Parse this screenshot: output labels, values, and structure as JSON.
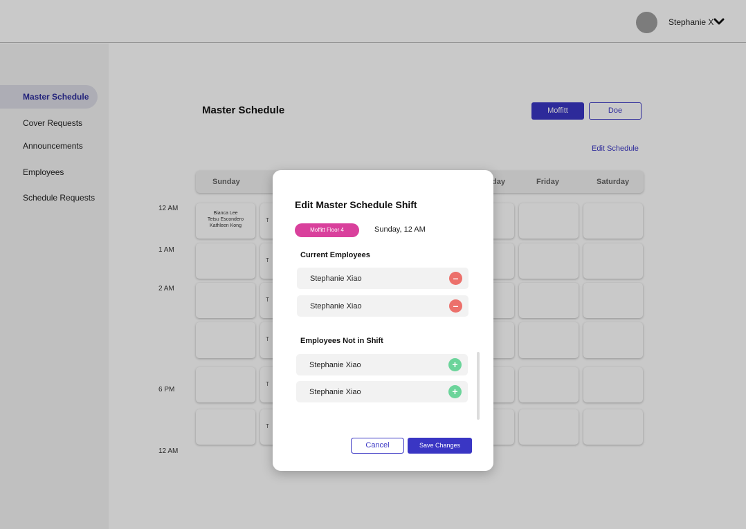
{
  "header": {
    "username": "Stephanie X"
  },
  "sidebar": {
    "items": [
      {
        "label": "Master Schedule",
        "active": true
      },
      {
        "label": "Cover Requests"
      },
      {
        "label": "Announcements"
      },
      {
        "label": "Employees"
      },
      {
        "label": "Schedule Requests"
      }
    ]
  },
  "main": {
    "title": "Master Schedule",
    "library_buttons": [
      "Moffitt",
      "Doe"
    ],
    "edit_link": "Edit Schedule",
    "days": [
      "Sunday",
      "Friday",
      "Saturday"
    ],
    "partial_day": "day",
    "times": [
      "12 AM",
      "1 AM",
      "2 AM",
      "6 PM",
      "12 AM"
    ],
    "first_cell_names": [
      "Bianca Lee",
      "Tetsu Escondero",
      "Kathleen Kong"
    ],
    "cell_t": "T"
  },
  "modal": {
    "title": "Edit Master Schedule Shift",
    "location_pill": "Moffitt Floor 4",
    "shift_time": "Sunday, 12 AM",
    "current_heading": "Current Employees",
    "current_employees": [
      "Stephanie Xiao",
      "Stephanie Xiao"
    ],
    "not_in_shift_heading": "Employees Not in Shift",
    "other_employees": [
      "Stephanie Xiao",
      "Stephanie Xiao"
    ],
    "cancel_label": "Cancel",
    "save_label": "Save Changes"
  },
  "colors": {
    "accent": "#3a36c4",
    "pill": "#d9409c",
    "remove": "#ec706b",
    "add": "#6bd49a"
  }
}
